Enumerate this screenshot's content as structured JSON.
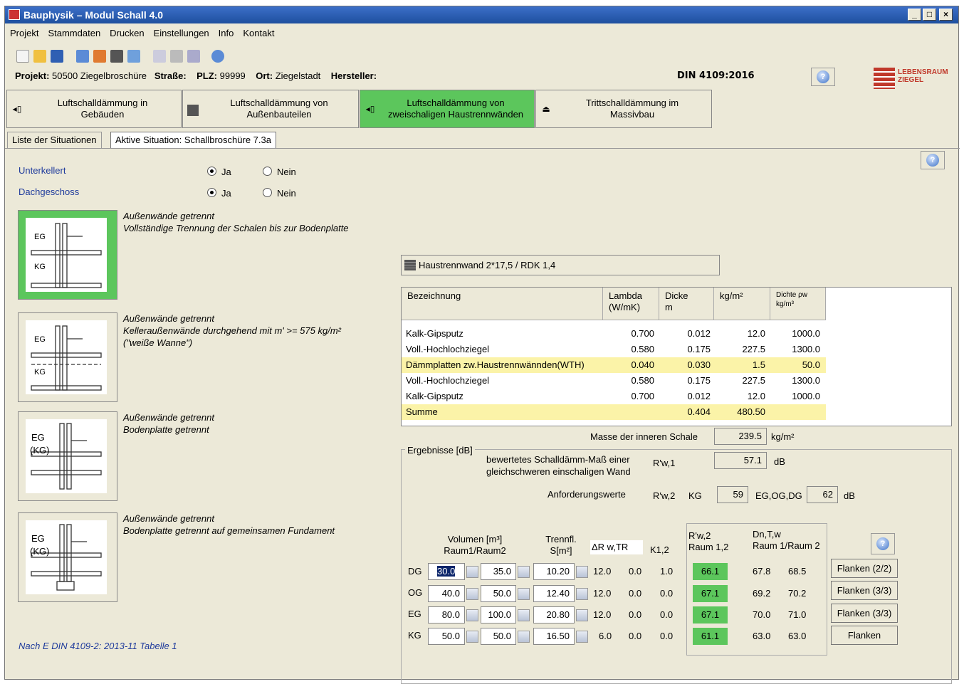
{
  "app": {
    "title": "Bauphysik – Modul Schall 4.0"
  },
  "menu": [
    "Projekt",
    "Stammdaten",
    "Drucken",
    "Einstellungen",
    "Info",
    "Kontakt"
  ],
  "project": {
    "projekt_label": "Projekt:",
    "projekt": "50500 Ziegelbroschüre",
    "strasse_label": "Straße:",
    "plz_label": "PLZ:",
    "plz": "99999",
    "ort_label": "Ort:",
    "ort": "Ziegelstadt",
    "hersteller_label": "Hersteller:",
    "norm": "DIN 4109:2016"
  },
  "logo": {
    "line1": "LEBENSRAUM",
    "line2": "ZIEGEL"
  },
  "nav": [
    {
      "line1": "Luftschalldämmung in",
      "line2": "Gebäuden"
    },
    {
      "line1": "Luftschalldämmung von",
      "line2": "Außenbauteilen"
    },
    {
      "line1": "Luftschalldämmung von",
      "line2": "zweischaligen Haustrennwänden"
    },
    {
      "line1": "Trittschalldämmung im",
      "line2": "Massivbau"
    }
  ],
  "tabs": [
    "Liste der Situationen",
    "Aktive Situation: Schallbroschüre 7.3a"
  ],
  "options": {
    "unterkellert": "Unterkellert",
    "dachgeschoss": "Dachgeschoss",
    "ja": "Ja",
    "nein": "Nein"
  },
  "situations": [
    {
      "l1": "Außenwände getrennt",
      "l2": "Vollständige Trennung der Schalen bis zur Bodenplatte",
      "l3": "",
      "top": "EG",
      "bot": "KG"
    },
    {
      "l1": "Außenwände getrennt",
      "l2": "Kelleraußenwände durchgehend mit m' >= 575 kg/m²",
      "l3": "(\"weiße Wanne\")",
      "top": "EG",
      "bot": "KG"
    },
    {
      "l1": "Außenwände getrennt",
      "l2": "Bodenplatte getrennt",
      "l3": "",
      "top": "EG",
      "bot": "(KG)"
    },
    {
      "l1": "Außenwände getrennt",
      "l2": "Bodenplatte getrennt auf gemeinsamen Fundament",
      "l3": "",
      "top": "EG",
      "bot": "(KG)"
    }
  ],
  "footnote": "Nach E DIN 4109-2: 2013-11 Tabelle 1",
  "wall": {
    "label": "Haustrennwand 2*17,5 / RDK 1,4"
  },
  "table": {
    "headers": {
      "bez": "Bezeichnung",
      "lambda1": "Lambda",
      "lambda2": "(W/mK)",
      "dicke1": "Dicke",
      "dicke2": "m",
      "mass": "kg/m²",
      "dichte1": "Dichte ρw",
      "dichte2": "kg/m³"
    },
    "rows": [
      {
        "bez": "Kalk-Gipsputz",
        "lambda": "0.700",
        "dicke": "0.012",
        "mass": "12.0",
        "dichte": "1000.0"
      },
      {
        "bez": "Voll.-Hochlochziegel",
        "lambda": "0.580",
        "dicke": "0.175",
        "mass": "227.5",
        "dichte": "1300.0"
      },
      {
        "bez": "Dämmplatten zw.Haustrennwännden(WTH)",
        "lambda": "0.040",
        "dicke": "0.030",
        "mass": "1.5",
        "dichte": "50.0"
      },
      {
        "bez": "Voll.-Hochlochziegel",
        "lambda": "0.580",
        "dicke": "0.175",
        "mass": "227.5",
        "dichte": "1300.0"
      },
      {
        "bez": "Kalk-Gipsputz",
        "lambda": "0.700",
        "dicke": "0.012",
        "mass": "12.0",
        "dichte": "1000.0"
      }
    ],
    "sum": {
      "label": "Summe",
      "dicke": "0.404",
      "mass": "480.50"
    }
  },
  "masse": {
    "label": "Masse der inneren Schale",
    "value": "239.5",
    "unit": "kg/m²"
  },
  "results": {
    "legend": "Ergebnisse [dB]",
    "rw_text1": "bewertetes Schalldämm-Maß einer",
    "rw_text2": "gleichschweren einschaligen Wand",
    "rw1_sym": "R'w,1",
    "rw1": "57.1",
    "db": "dB",
    "anf_label": "Anforderungswerte",
    "rw2_sym": "R'w,2",
    "kg_label": "KG",
    "kg_val": "59",
    "eg_label": "EG,OG,DG",
    "eg_val": "62",
    "col_vol1": "Volumen [m³]",
    "col_vol2": "Raum1/Raum2",
    "col_tr1": "Trennfl.",
    "col_tr2": "S[m²]",
    "col_dr": "ΔR w,TR",
    "col_k": "K1,2",
    "col_rw1": "R'w,2",
    "col_rw2": "Raum 1,2",
    "col_dn1": "Dn,T,w",
    "col_dn2": "Raum 1/Raum 2",
    "rows": [
      {
        "floor": "DG",
        "v1": "30.0",
        "v2": "35.0",
        "s": "10.20",
        "dr": "12.0",
        "x": "0.0",
        "k": "1.0",
        "rw": "66.1",
        "d1": "67.8",
        "d2": "68.5",
        "btn": "Flanken (2/2)"
      },
      {
        "floor": "OG",
        "v1": "40.0",
        "v2": "50.0",
        "s": "12.40",
        "dr": "12.0",
        "x": "0.0",
        "k": "0.0",
        "rw": "67.1",
        "d1": "69.2",
        "d2": "70.2",
        "btn": "Flanken (3/3)"
      },
      {
        "floor": "EG",
        "v1": "80.0",
        "v2": "100.0",
        "s": "20.80",
        "dr": "12.0",
        "x": "0.0",
        "k": "0.0",
        "rw": "67.1",
        "d1": "70.0",
        "d2": "71.0",
        "btn": "Flanken (3/3)"
      },
      {
        "floor": "KG",
        "v1": "50.0",
        "v2": "50.0",
        "s": "16.50",
        "dr": "6.0",
        "x": "0.0",
        "k": "0.0",
        "rw": "61.1",
        "d1": "63.0",
        "d2": "63.0",
        "btn": "Flanken"
      }
    ]
  }
}
